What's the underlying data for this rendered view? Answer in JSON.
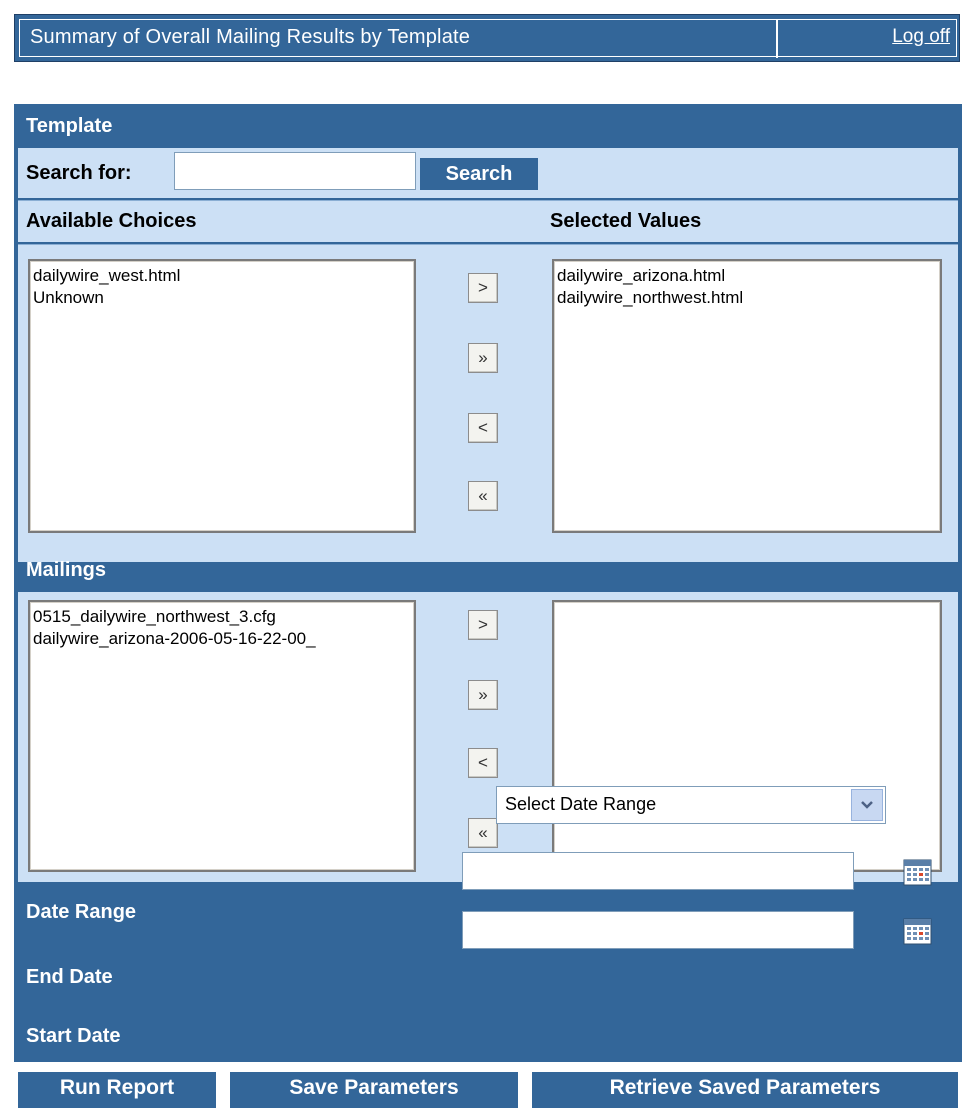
{
  "header": {
    "title": "Summary of Overall Mailing Results by Template",
    "logoff_label": "Log off"
  },
  "template": {
    "section_title": "Template",
    "search_label": "Search for:",
    "search_value": "",
    "search_button": "Search",
    "available_label": "Available Choices",
    "selected_label": "Selected Values",
    "available_items": [
      "dailywire_west.html",
      "Unknown"
    ],
    "selected_items": [
      "dailywire_arizona.html",
      "dailywire_northwest.html"
    ]
  },
  "mailings": {
    "section_title": "Mailings",
    "available_items": [
      "0515_dailywire_northwest_3.cfg",
      "dailywire_arizona-2006-05-16-22-00_"
    ],
    "selected_items": []
  },
  "move_buttons": {
    "add": ">",
    "add_all": "»",
    "remove": "<",
    "remove_all": "«"
  },
  "dates": {
    "date_range_label": "Date Range",
    "date_range_selected": "Select Date Range",
    "end_date_label": "End Date",
    "end_date_value": "",
    "start_date_label": "Start Date",
    "start_date_value": ""
  },
  "actions": {
    "run_report": "Run Report",
    "save_parameters": "Save Parameters",
    "retrieve_saved": "Retrieve Saved Parameters"
  },
  "colors": {
    "brand_blue": "#336699",
    "panel_light": "#cce0f5"
  }
}
